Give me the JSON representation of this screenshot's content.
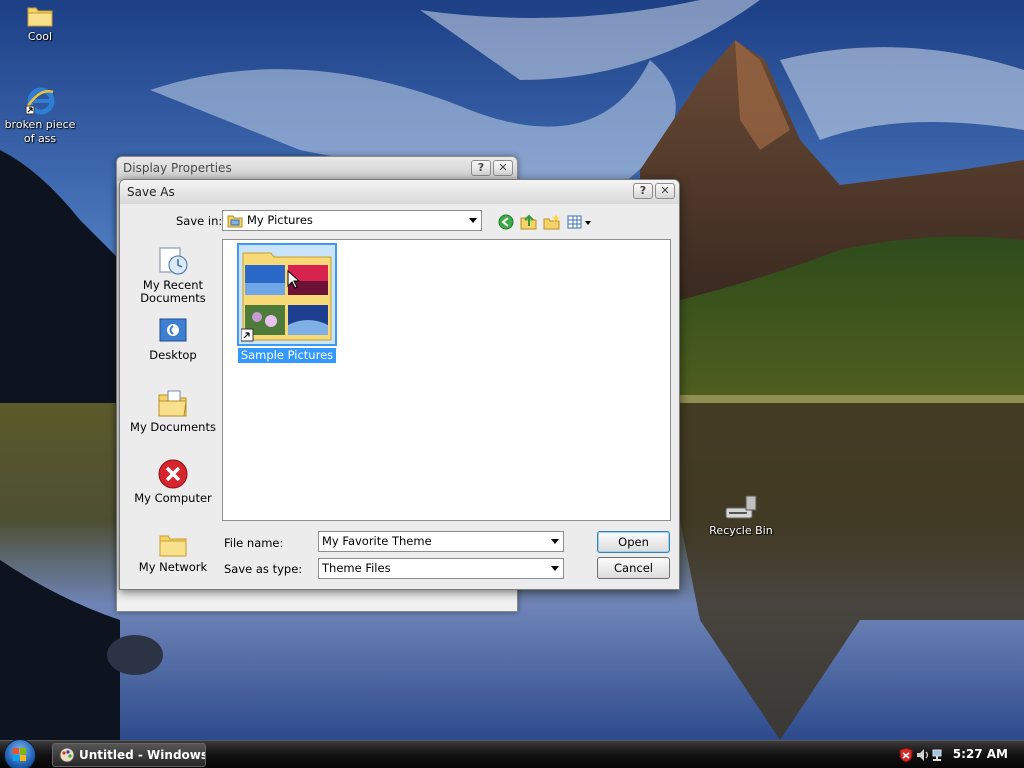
{
  "desktop": {
    "icons": [
      {
        "label": "Cool",
        "icon": "folder-icon"
      },
      {
        "label": "broken piece\nof ass",
        "icon": "internet-explorer-icon"
      },
      {
        "label": "Recycle Bin",
        "icon": "recycle-bin-icon"
      }
    ]
  },
  "display_properties": {
    "title": "Display Properties",
    "help_label": "?",
    "close_label": "✕"
  },
  "save_as": {
    "title": "Save As",
    "help_label": "?",
    "close_label": "✕",
    "save_in_label": "Save in:",
    "save_in_value": "My Pictures",
    "places": [
      {
        "label": "My Recent\nDocuments",
        "icon": "recent-documents-icon"
      },
      {
        "label": "Desktop",
        "icon": "desktop-icon"
      },
      {
        "label": "My Documents",
        "icon": "my-documents-icon"
      },
      {
        "label": "My Computer",
        "icon": "error-icon"
      },
      {
        "label": "My Network",
        "icon": "folder-icon"
      }
    ],
    "files": [
      {
        "name": "Sample Pictures",
        "icon": "picture-folder-icon",
        "selected": true
      }
    ],
    "file_name_label": "File name:",
    "file_name_value": "My Favorite Theme",
    "save_as_type_label": "Save as type:",
    "save_as_type_value": "Theme Files",
    "open_label": "Open",
    "cancel_label": "Cancel"
  },
  "taskbar": {
    "task_label": "Untitled - Windows ...",
    "clock": "5:27 AM"
  }
}
